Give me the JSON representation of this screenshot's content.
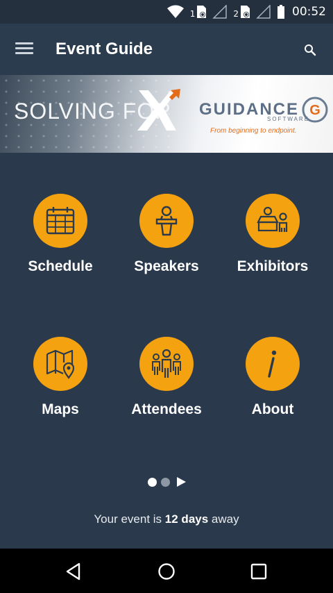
{
  "status_bar": {
    "sim1": "1",
    "sim2": "2",
    "time": "00:52",
    "icons": [
      "wifi-icon",
      "sim-1-icon",
      "signal-icon",
      "sim-2-icon",
      "signal-icon",
      "battery-icon"
    ]
  },
  "app_bar": {
    "title": "Event Guide",
    "menu_icon": "menu-icon",
    "search_icon": "search-icon"
  },
  "banner": {
    "left_text": "SOLVING FOR",
    "x_letter": "X",
    "brand": "GUIDANCE",
    "brand_sub": "SOFTWARE",
    "logo_letter": "G",
    "tagline": "From beginning to endpoint."
  },
  "tiles": [
    {
      "label": "Schedule",
      "icon": "calendar-icon"
    },
    {
      "label": "Speakers",
      "icon": "speaker-podium-icon"
    },
    {
      "label": "Exhibitors",
      "icon": "exhibitor-booth-icon"
    },
    {
      "label": "Maps",
      "icon": "map-pin-icon"
    },
    {
      "label": "Attendees",
      "icon": "people-group-icon"
    },
    {
      "label": "About",
      "icon": "info-icon"
    }
  ],
  "pager": {
    "pages": 2,
    "current": 1,
    "next_icon": "arrow-right-icon"
  },
  "countdown": {
    "prefix": "Your event is",
    "value": "12 days",
    "suffix": "away"
  },
  "nav_bar": {
    "icons": [
      "back-icon",
      "home-icon",
      "recents-icon"
    ]
  },
  "colors": {
    "background": "#2a3a4c",
    "accent": "#f4a20f",
    "app_bar": "#2b3c4e"
  }
}
